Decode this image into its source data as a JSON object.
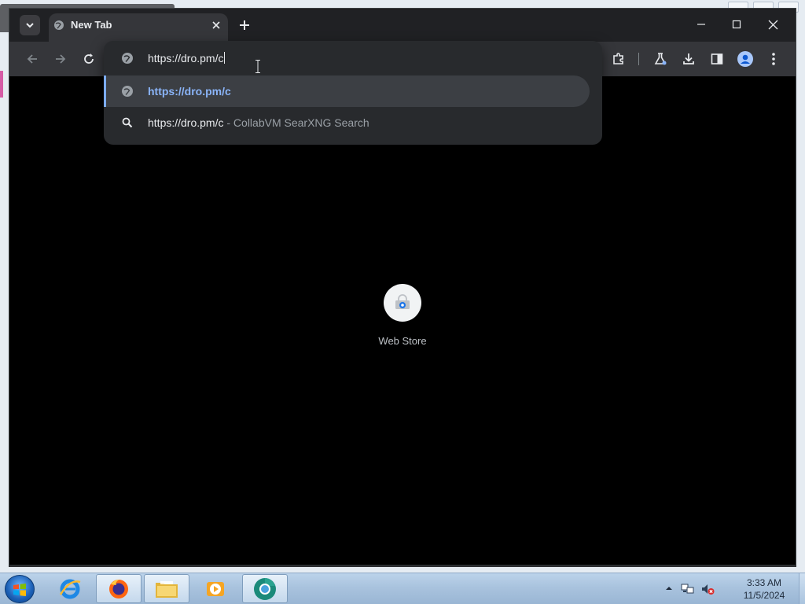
{
  "browser": {
    "tab": {
      "title": "New Tab"
    },
    "omnibox": {
      "input_value": "https://dro.pm/c",
      "suggestions": [
        {
          "text": "https://dro.pm/c",
          "suffix": "",
          "icon": "globe-icon",
          "selected": true
        },
        {
          "text": "https://dro.pm/c",
          "suffix": " - CollabVM SearXNG Search",
          "icon": "search-icon",
          "selected": false
        }
      ]
    },
    "new_tab_page": {
      "shortcuts": [
        {
          "label": "Web Store",
          "icon": "web-store-icon"
        }
      ]
    },
    "colors": {
      "frame": "#202124",
      "toolbar": "#35363a",
      "accent": "#8ab4f8",
      "selected_row_bar": "#7cacf8"
    }
  },
  "taskbar": {
    "apps": [
      {
        "name": "Internet Explorer",
        "icon": "internet-explorer-icon"
      },
      {
        "name": "Firefox",
        "icon": "firefox-icon"
      },
      {
        "name": "File Explorer",
        "icon": "folder-icon"
      },
      {
        "name": "Media Player",
        "icon": "media-player-icon"
      },
      {
        "name": "Chrome",
        "icon": "chromium-icon"
      }
    ],
    "clock": {
      "time": "3:33 AM",
      "date": "11/5/2024"
    }
  }
}
